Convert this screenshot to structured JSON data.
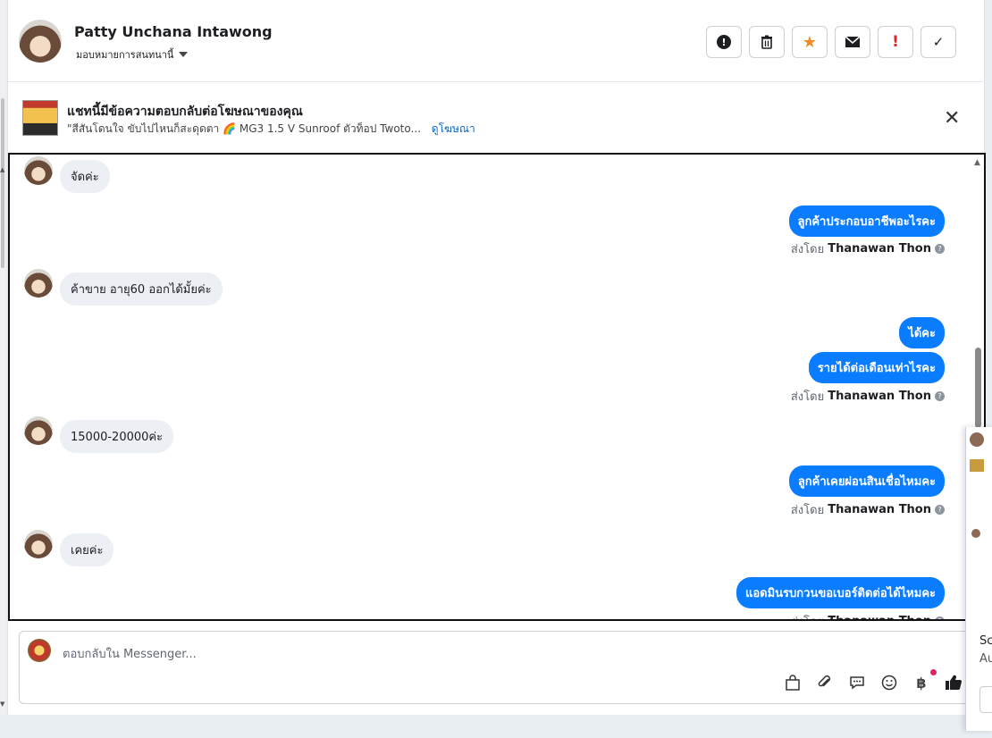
{
  "header": {
    "contact_name": "Patty Unchana Intawong",
    "assign_label": "มอบหมายการสนทนานี้"
  },
  "actions": [
    {
      "name": "report-spam-button",
      "icon": "exclamation-circle-icon"
    },
    {
      "name": "delete-button",
      "icon": "trash-icon"
    },
    {
      "name": "star-button",
      "icon": "star-icon"
    },
    {
      "name": "mark-unread-button",
      "icon": "envelope-icon"
    },
    {
      "name": "important-button",
      "icon": "exclamation-icon"
    },
    {
      "name": "done-button",
      "icon": "check-icon"
    }
  ],
  "ad": {
    "title": "แชทนี้มีข้อความตอบกลับต่อโฆษณาของคุณ",
    "description": "\"สีสันโดนใจ ขับไปไหนก็สะดุดตา 🌈 MG3 1.5 V Sunroof ตัวท็อป Twoto...",
    "link": "ดูโฆษณา"
  },
  "messages": {
    "m1": "จัดค่ะ",
    "m2": "ลูกค้าประกอบอาชีพอะไรคะ",
    "m3": "ค้าขาย อายุ60 ออกได้มั้ยค่ะ",
    "m4": "ได้คะ",
    "m5": "รายได้ต่อเดือนเท่าไรคะ",
    "m6": "15000-20000ค่ะ",
    "m7": "ลูกค้าเคยผ่อนสินเชื่อไหมคะ",
    "m8": "เคยค่ะ",
    "m9": "แอดมินรบกวนขอเบอร์ติดต่อได้ไหมคะ"
  },
  "sent_by": {
    "prefix": "ส่งโดย",
    "agent": "Thanawan Thon"
  },
  "composer": {
    "placeholder": "ตอบกลับใน Messenger..."
  },
  "side_peek": {
    "line1": "Sc",
    "line2": "Au"
  },
  "colors": {
    "accent": "#0a7cff",
    "star": "#f08a24",
    "alert": "#e02424"
  }
}
